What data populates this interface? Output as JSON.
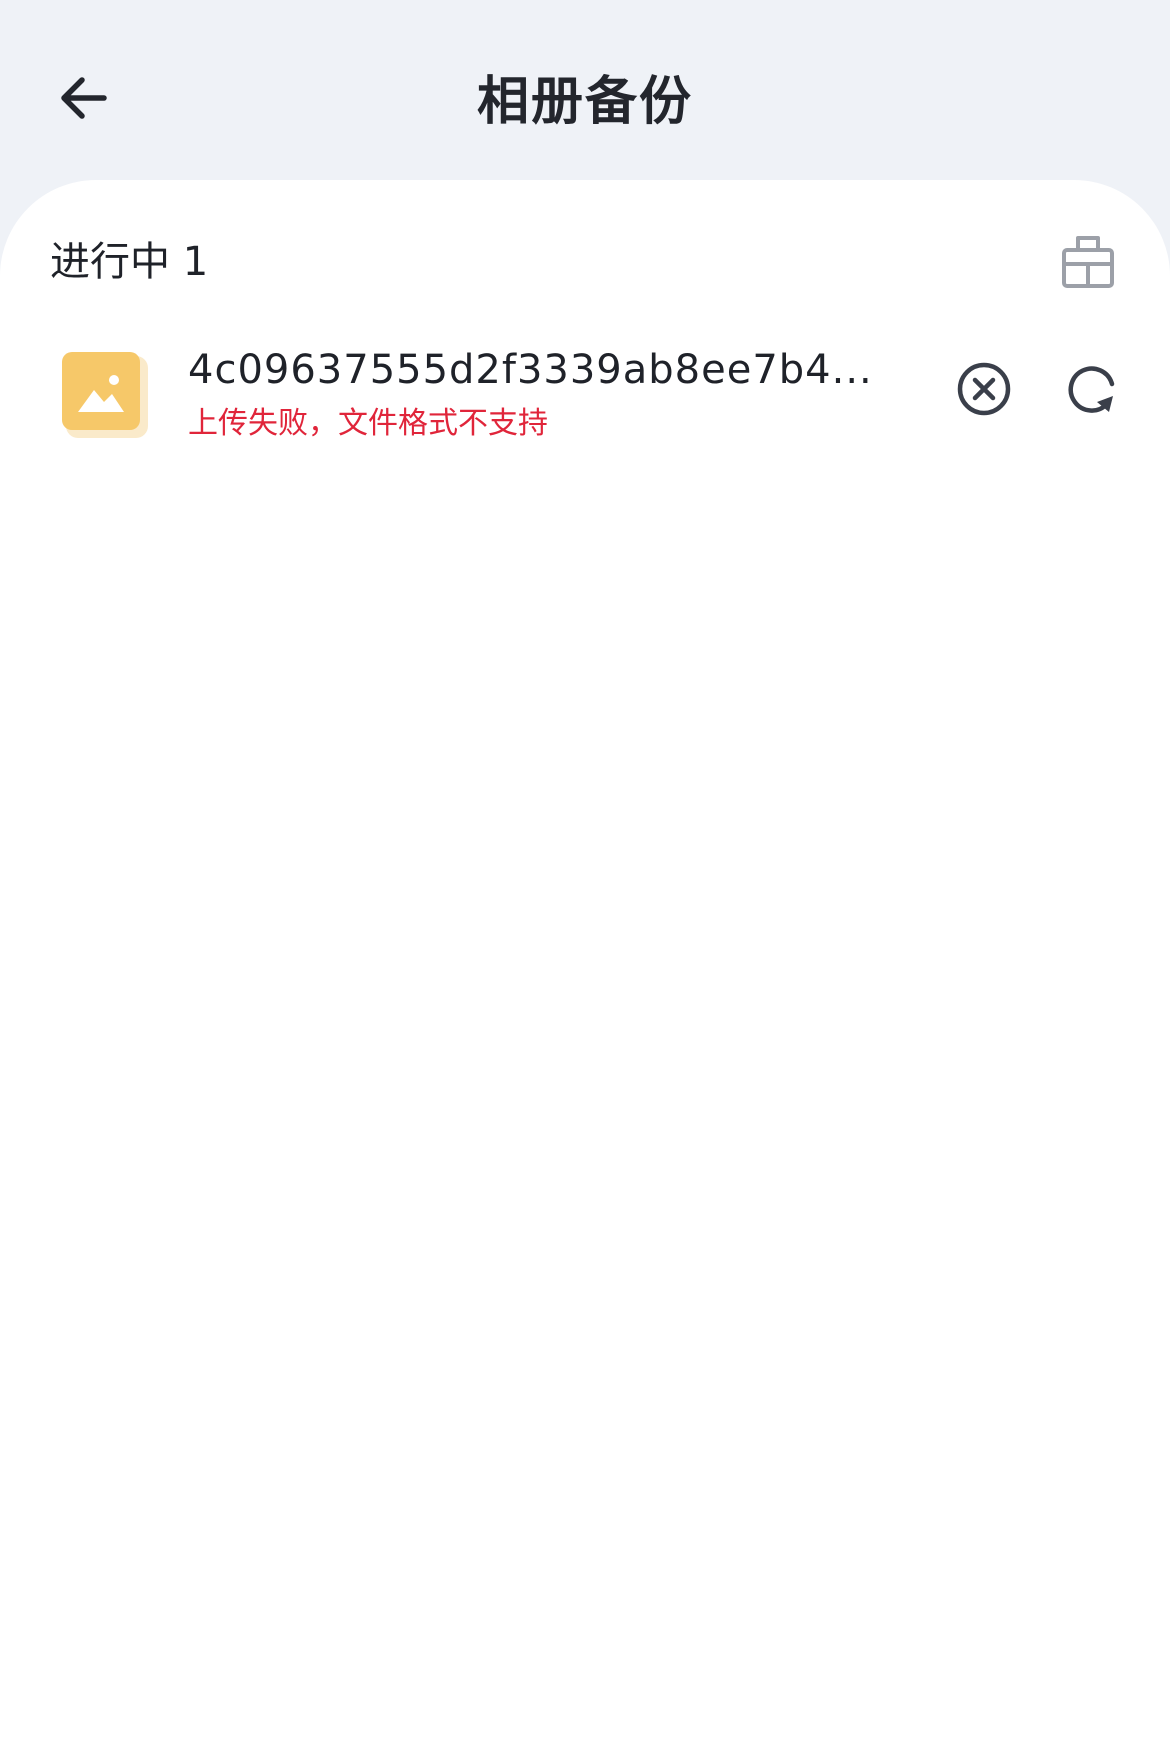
{
  "nav": {
    "back_icon": "arrow-left-icon",
    "title": "相册备份"
  },
  "section": {
    "header": "进行中 1",
    "clear_icon": "clear-icon"
  },
  "tasks": [
    {
      "thumb_icon": "image-file-icon",
      "name": "4c09637555d2f3339ab8ee7b4...",
      "status": "上传失败，文件格式不支持",
      "cancel_icon": "cancel-circle-icon",
      "retry_icon": "retry-icon"
    }
  ],
  "colors": {
    "background": "#eff2f7",
    "panel": "#ffffff",
    "text_primary": "#1f2229",
    "error": "#e0253a",
    "icon_gray": "#9ca0a8",
    "thumb_yellow": "#f6c869"
  }
}
